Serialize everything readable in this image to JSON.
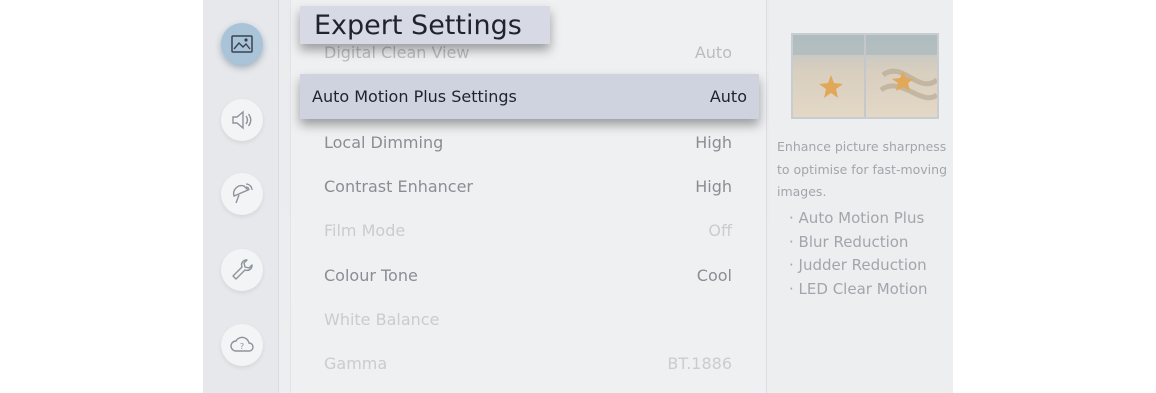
{
  "header": {
    "title": "Expert Settings"
  },
  "menu": {
    "partial_top": {
      "label": "Digital Clean View",
      "value": "Auto"
    },
    "selected": {
      "label": "Auto Motion Plus Settings",
      "value": "Auto"
    },
    "items": [
      {
        "label": "Local Dimming",
        "value": "High"
      },
      {
        "label": "Contrast Enhancer",
        "value": "High"
      },
      {
        "label": "Film Mode",
        "value": "Off"
      },
      {
        "label": "Colour Tone",
        "value": "Cool"
      },
      {
        "label": "White Balance",
        "value": ""
      },
      {
        "label": "Gamma",
        "value": "BT.1886"
      }
    ]
  },
  "info": {
    "description": "Enhance picture sharpness to optimise for fast-moving images.",
    "bullets": [
      "Auto Motion Plus",
      "Blur Reduction",
      "Judder Reduction",
      "LED Clear Motion"
    ]
  },
  "rail": {
    "icons": [
      "picture-icon",
      "sound-icon",
      "broadcasting-icon",
      "general-icon",
      "support-icon"
    ],
    "active": "picture-icon"
  },
  "colors": {
    "selected_bg": "#cfd3e0",
    "active_rail": "#a9c3d8",
    "text_dark": "#1e2330"
  }
}
